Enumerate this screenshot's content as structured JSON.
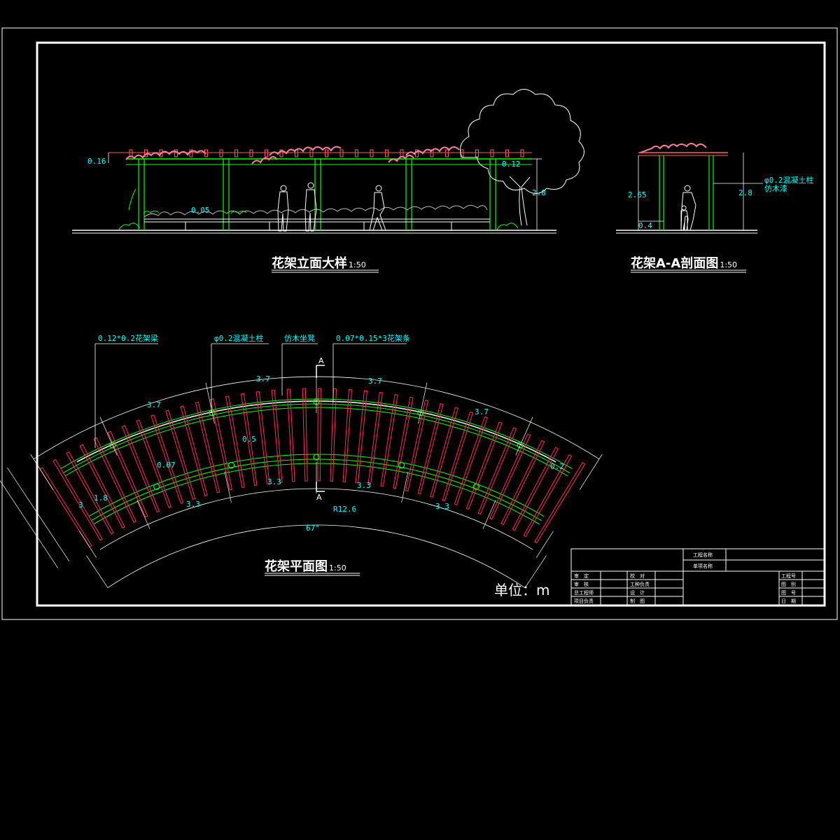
{
  "titles": {
    "elevation": "花架立面大样",
    "elevation_scale": "1:50",
    "section": "花架A-A剖面图",
    "section_scale": "1:50",
    "plan": "花架平面图",
    "plan_scale": "1:50",
    "unit": "单位：m"
  },
  "elevation_dims": {
    "top": "0.16",
    "rail": "0.05",
    "beam": "0.12",
    "height": "2.8"
  },
  "section_dims": {
    "column_height": "2.65",
    "total_height": "2.8",
    "seat": "0.4",
    "note1": "φ0.2混凝土柱",
    "note2": "仿木漆"
  },
  "plan_callouts": {
    "beam": "0.12*0.2花架梁",
    "column": "φ0.2混凝土柱",
    "seat": "仿木坐凳",
    "rafter": "0.07*0.15*3花架条"
  },
  "plan_dims": {
    "outer": [
      "3.7",
      "3.7",
      "3.7",
      "3.7"
    ],
    "inner": [
      "3.3",
      "3.3",
      "3.3",
      "3.3"
    ],
    "depth": "1.8",
    "overall": "3",
    "rafter_gap": "0.5",
    "rafter_width": "0.07",
    "overhang": "0.2",
    "radius": "R12.6",
    "angle": "67°",
    "section_mark": "A"
  },
  "title_block": {
    "project_name": "工程名称",
    "item_name": "单项名称",
    "left_rows": [
      [
        "审　定",
        "校　对"
      ],
      [
        "审　核",
        "工种负责"
      ],
      [
        "总工程师",
        "设　计"
      ],
      [
        "项目负责",
        "制　图"
      ]
    ],
    "right_rows": [
      "工程号",
      "图　别",
      "图　号",
      "日　期"
    ]
  }
}
